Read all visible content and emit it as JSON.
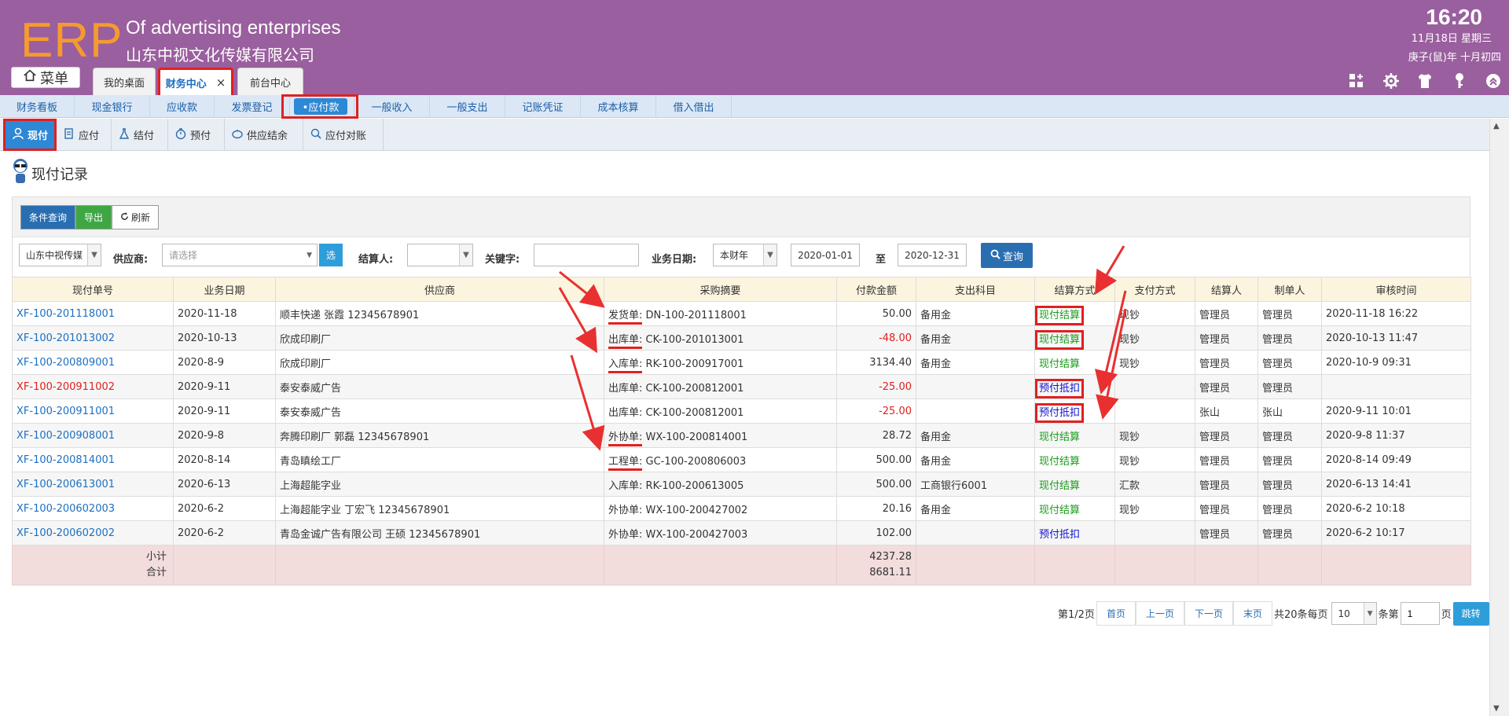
{
  "header": {
    "logo": "ERP",
    "company_en": "Of advertising enterprises",
    "company_cn": "山东中视文化传媒有限公司",
    "time": "16:20",
    "date": "11月18日 星期三",
    "lunar": "庚子(鼠)年 十月初四",
    "menu_label": "菜单",
    "tabs": [
      {
        "label": "我的桌面"
      },
      {
        "label": "财务中心",
        "close": "×"
      },
      {
        "label": "前台中心"
      }
    ],
    "icons": [
      "grid-add-icon",
      "gear-icon",
      "shirt-icon",
      "key-icon",
      "chevron-up-icon"
    ]
  },
  "subnav": {
    "items": [
      "财务看板",
      "现金银行",
      "应收款",
      "发票登记",
      "•应付款",
      "一般收入",
      "一般支出",
      "记账凭证",
      "成本核算",
      "借入借出"
    ]
  },
  "tooltabs": [
    "现付",
    "应付",
    "结付",
    "预付",
    "供应结余",
    "应付对账"
  ],
  "page_title": "现付记录",
  "toolbar": {
    "cond": "条件查询",
    "export": "导出",
    "refresh": "刷新"
  },
  "filter": {
    "company": "山东中视传媒",
    "supplier_label": "供应商:",
    "supplier_placeholder": "请选择",
    "select_btn": "选",
    "settler_label": "结算人:",
    "keyword_label": "关键字:",
    "date_label": "业务日期:",
    "period": "本财年",
    "date_from": "2020-01-01",
    "to": "至",
    "date_to": "2020-12-31",
    "query": "查询"
  },
  "table": {
    "columns": [
      "现付单号",
      "业务日期",
      "供应商",
      "采购摘要",
      "付款金额",
      "支出科目",
      "结算方式",
      "支付方式",
      "结算人",
      "制单人",
      "审核时间"
    ],
    "rows": [
      {
        "code": "XF-100-201118001",
        "date": "2020-11-18",
        "supplier": "顺丰快递 张霞 12345678901",
        "doc_type": "发货单:",
        "doc_no": "DN-100-201118001",
        "amount": "50.00",
        "account": "备用金",
        "method": "现付结算",
        "pay": "现钞",
        "settler": "管理员",
        "maker": "管理员",
        "audit": "2020-11-18 16:22"
      },
      {
        "code": "XF-100-201013002",
        "date": "2020-10-13",
        "supplier": "欣成印刷厂",
        "doc_type": "出库单:",
        "doc_no": "CK-100-201013001",
        "amount": "-48.00",
        "account": "备用金",
        "method": "现付结算",
        "pay": "现钞",
        "settler": "管理员",
        "maker": "管理员",
        "audit": "2020-10-13 11:47"
      },
      {
        "code": "XF-100-200809001",
        "date": "2020-8-9",
        "supplier": "欣成印刷厂",
        "doc_type": "入库单:",
        "doc_no": "RK-100-200917001",
        "amount": "3134.40",
        "account": "备用金",
        "method": "现付结算",
        "pay": "现钞",
        "settler": "管理员",
        "maker": "管理员",
        "audit": "2020-10-9 09:31"
      },
      {
        "code": "XF-100-200911002",
        "date": "2020-9-11",
        "supplier": "泰安泰威广告",
        "doc_type": "出库单:",
        "doc_no": "CK-100-200812001",
        "amount": "-25.00",
        "account": "",
        "method": "预付抵扣",
        "pay": "",
        "settler": "管理员",
        "maker": "管理员",
        "audit": ""
      },
      {
        "code": "XF-100-200911001",
        "date": "2020-9-11",
        "supplier": "泰安泰威广告",
        "doc_type": "出库单:",
        "doc_no": "CK-100-200812001",
        "amount": "-25.00",
        "account": "",
        "method": "预付抵扣",
        "pay": "",
        "settler": "张山",
        "maker": "张山",
        "audit": "2020-9-11 10:01"
      },
      {
        "code": "XF-100-200908001",
        "date": "2020-9-8",
        "supplier": "奔腾印刷厂 郭磊 12345678901",
        "doc_type": "外协单:",
        "doc_no": "WX-100-200814001",
        "amount": "28.72",
        "account": "备用金",
        "method": "现付结算",
        "pay": "现钞",
        "settler": "管理员",
        "maker": "管理员",
        "audit": "2020-9-8 11:37"
      },
      {
        "code": "XF-100-200814001",
        "date": "2020-8-14",
        "supplier": "青岛瞋绘工厂",
        "doc_type": "工程单:",
        "doc_no": "GC-100-200806003",
        "amount": "500.00",
        "account": "备用金",
        "method": "现付结算",
        "pay": "现钞",
        "settler": "管理员",
        "maker": "管理员",
        "audit": "2020-8-14 09:49"
      },
      {
        "code": "XF-100-200613001",
        "date": "2020-6-13",
        "supplier": "上海超能字业",
        "doc_type": "入库单:",
        "doc_no": "RK-100-200613005",
        "amount": "500.00",
        "account": "工商银行6001",
        "method": "现付结算",
        "pay": "汇款",
        "settler": "管理员",
        "maker": "管理员",
        "audit": "2020-6-13 14:41"
      },
      {
        "code": "XF-100-200602003",
        "date": "2020-6-2",
        "supplier": "上海超能字业 丁宏飞 12345678901",
        "doc_type": "外协单:",
        "doc_no": "WX-100-200427002",
        "amount": "20.16",
        "account": "备用金",
        "method": "现付结算",
        "pay": "现钞",
        "settler": "管理员",
        "maker": "管理员",
        "audit": "2020-6-2 10:18"
      },
      {
        "code": "XF-100-200602002",
        "date": "2020-6-2",
        "supplier": "青岛金诚广告有限公司 王硕 12345678901",
        "doc_type": "外协单:",
        "doc_no": "WX-100-200427003",
        "amount": "102.00",
        "account": "",
        "method": "预付抵扣",
        "pay": "",
        "settler": "管理员",
        "maker": "管理员",
        "audit": "2020-6-2 10:17"
      }
    ],
    "subtotal_label": "小计",
    "total_label": "合计",
    "subtotal": "4237.28",
    "total": "8681.11"
  },
  "pager": {
    "page_info": "第1/2页",
    "first": "首页",
    "prev": "上一页",
    "next": "下一页",
    "last": "末页",
    "total_text": "共20条每页",
    "per_page": "10",
    "unit": "条第",
    "page_input": "1",
    "page_suffix": "页",
    "jump": "跳转"
  },
  "colors": {
    "header_bg": "#9a5f9e",
    "logo": "#f59b2e",
    "link": "#1d6fc0",
    "highlight": "#e02020",
    "cash": "#1a9a1a",
    "prepay": "#1010cc"
  }
}
